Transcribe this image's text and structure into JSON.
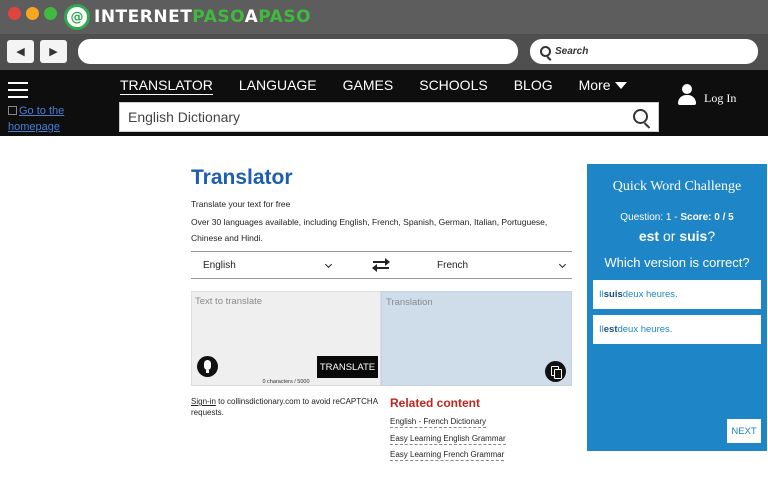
{
  "browser": {
    "logo": {
      "badge": "@",
      "part1": "INTERNET",
      "part2": "PASO",
      "mid": "A",
      "part3": "PASO"
    },
    "search_placeholder": "Search",
    "back_icon": "◀",
    "forward_icon": "▶"
  },
  "header": {
    "home_link": "Go to the homepage",
    "menu": [
      "TRANSLATOR",
      "LANGUAGE",
      "GAMES",
      "SCHOOLS",
      "BLOG",
      "More"
    ],
    "search_placeholder": "English Dictionary",
    "login": "Log In"
  },
  "translator": {
    "title": "Translator",
    "subtitle": "Translate your text for free",
    "description": "Over 30 languages available, including English, French, Spanish, German, Italian, Portuguese, Chinese and Hindi.",
    "source_lang": "English",
    "target_lang": "French",
    "source_placeholder": "Text to translate",
    "target_placeholder": "Translation",
    "translate_button": "TRANSLATE",
    "char_count": "0 characters / 5000",
    "signin_link": "Sign-in",
    "signin_text": " to collinsdictionary.com to avoid reCAPTCHA requests."
  },
  "related": {
    "title": "Related content",
    "links": [
      "English - French Dictionary",
      "Easy Learning English Grammar",
      "Easy Learning French Grammar"
    ]
  },
  "quiz": {
    "title": "Quick Word Challenge",
    "question_label": "Question: 1",
    "separator": " - ",
    "score_label": "Score: 0 / 5",
    "word1": "est",
    "or_text": " or ",
    "word2": "suis",
    "qmark": "?",
    "question": "Which version is correct?",
    "options": [
      {
        "prefix": "Il ",
        "bold": "suis",
        "suffix": " deux heures."
      },
      {
        "prefix": "Il ",
        "bold": "est",
        "suffix": " deux heures."
      }
    ],
    "next_button": "NEXT"
  },
  "colors": {
    "accent_blue": "#1e85c6",
    "title_blue": "#1c5fb0",
    "related_red": "#c0261f",
    "target_bg": "#cfddeb"
  }
}
